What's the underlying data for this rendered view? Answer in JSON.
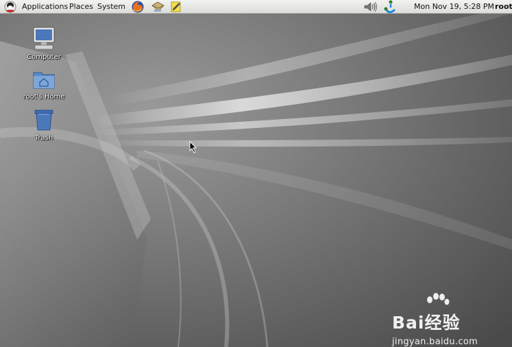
{
  "panel": {
    "menus": [
      {
        "label": "Applications"
      },
      {
        "label": "Places"
      },
      {
        "label": "System"
      }
    ],
    "launchers": [
      "firefox-icon",
      "mail-icon",
      "notes-icon"
    ],
    "tray_icons": [
      "volume-icon",
      "network-update-icon"
    ],
    "clock": "Mon Nov 19,  5:28 PM",
    "user": "root"
  },
  "desktop": {
    "icons": [
      {
        "label": "Computer",
        "icon": "computer-icon"
      },
      {
        "label": "root's Home",
        "icon": "home-folder-icon"
      },
      {
        "label": "Trash",
        "icon": "trash-icon"
      }
    ]
  },
  "watermark": {
    "brand": "Bai经验",
    "url": "jingyan.baidu.com"
  },
  "colors": {
    "panel_bg": "#e8e8e5",
    "wallpaper_base": "#6e6e6e",
    "icon_blue": "#4a78b8"
  }
}
